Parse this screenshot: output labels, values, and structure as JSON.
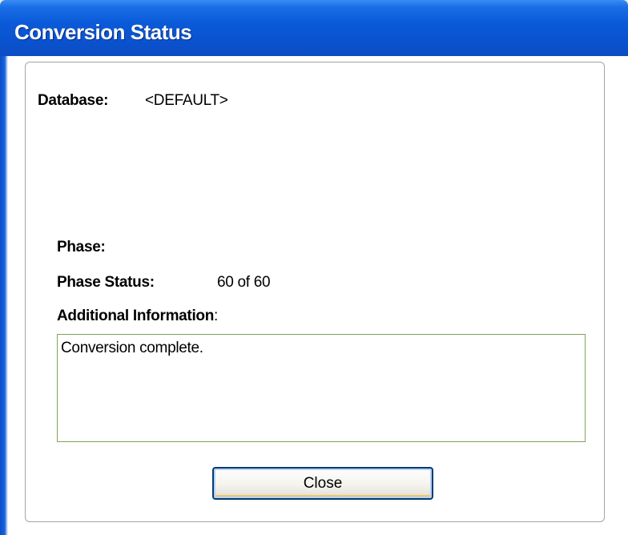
{
  "window": {
    "title": "Conversion Status"
  },
  "database": {
    "label": "Database:",
    "value": "<DEFAULT>"
  },
  "phase": {
    "label": "Phase:",
    "value": ""
  },
  "phase_status": {
    "label": "Phase Status:",
    "value": "60 of 60"
  },
  "additional_info": {
    "label": "Additional Information",
    "colon": ":",
    "text": "Conversion complete."
  },
  "buttons": {
    "close_label": "Close"
  },
  "colors": {
    "titlebar": "#0a53d0",
    "info_border": "#7fa35a",
    "button_border": "#003c74"
  }
}
